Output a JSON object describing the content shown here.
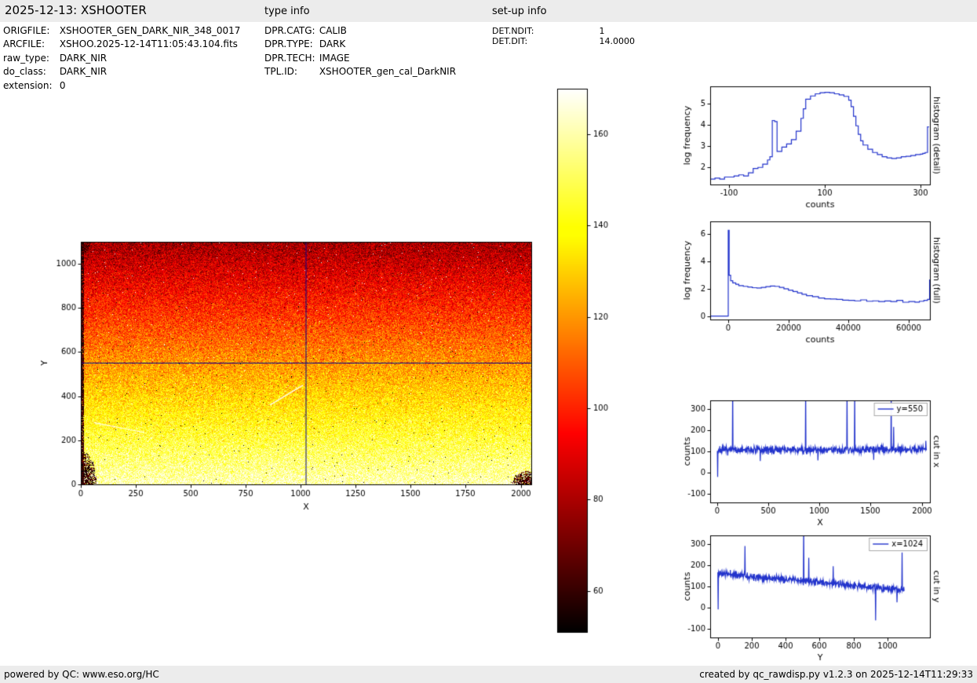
{
  "header": {
    "title": "2025-12-13: XSHOOTER",
    "type_info_label": "type info",
    "setup_info_label": "set-up info"
  },
  "file_info": {
    "rows": [
      {
        "label": "ORIGFILE:",
        "value": "XSHOOTER_GEN_DARK_NIR_348_0017"
      },
      {
        "label": "ARCFILE:",
        "value": "XSHOO.2025-12-14T11:05:43.104.fits"
      },
      {
        "label": "raw_type:",
        "value": "DARK_NIR"
      },
      {
        "label": "do_class:",
        "value": "DARK_NIR"
      },
      {
        "label": "extension:",
        "value": "0"
      }
    ]
  },
  "type_info": {
    "rows": [
      {
        "label": "DPR.CATG:",
        "value": "CALIB"
      },
      {
        "label": "DPR.TYPE:",
        "value": "DARK"
      },
      {
        "label": "DPR.TECH:",
        "value": "IMAGE"
      },
      {
        "label": "TPL.ID:",
        "value": "XSHOOTER_gen_cal_DarkNIR"
      }
    ]
  },
  "setup_info": {
    "rows": [
      {
        "label": "DET.NDIT:",
        "value": "1"
      },
      {
        "label": "DET.DIT:",
        "value": "14.0000"
      }
    ]
  },
  "footer": {
    "left": "powered by QC: www.eso.org/HC",
    "right": "created by qc_rawdisp.py v1.2.3 on 2025-12-14T11:29:33"
  },
  "colors": {
    "line_blue": "#2233cc",
    "crosshair": "#00008b",
    "bar_bg": "#ececec",
    "axis": "#000000"
  },
  "chart_data": [
    {
      "id": "detector_image",
      "type": "heatmap",
      "description": "raw NIR dark frame, brightness decreasing from bottom (~160 counts) to top (~80 counts), hot colormap, scattered hot/dead pixels, dark detector edges bottom-left and bottom-right",
      "xlabel": "X",
      "ylabel": "Y",
      "xlim": [
        0,
        2048
      ],
      "ylim": [
        0,
        1100
      ],
      "x_ticks": [
        0,
        250,
        500,
        750,
        1000,
        1250,
        1500,
        1750,
        2000
      ],
      "y_ticks": [
        0,
        200,
        400,
        600,
        800,
        1000
      ],
      "colormap": "hot",
      "display_min": 51,
      "display_max": 170,
      "counts_bottom": 162,
      "counts_top": 78,
      "noise_sigma": 9,
      "crosshair": {
        "x": 1024,
        "y": 550
      }
    },
    {
      "id": "colorbar",
      "type": "colorbar",
      "ticks": [
        60,
        80,
        100,
        120,
        140,
        160
      ],
      "display_min": 51,
      "display_max": 170,
      "colormap": "hot"
    },
    {
      "id": "histogram_detail",
      "type": "line",
      "style": "step",
      "right_label": "histogram (detail)",
      "xlabel": "counts",
      "ylabel": "log frequency",
      "xlim": [
        -140,
        320
      ],
      "ylim": [
        1.2,
        5.8
      ],
      "x_ticks": [
        -100,
        100,
        300
      ],
      "y_ticks": [
        2,
        3,
        4,
        5
      ],
      "x": [
        -140,
        -130,
        -120,
        -110,
        -100,
        -90,
        -80,
        -70,
        -60,
        -50,
        -40,
        -30,
        -20,
        -15,
        -10,
        -5,
        0,
        10,
        20,
        30,
        40,
        50,
        55,
        60,
        70,
        80,
        90,
        100,
        110,
        120,
        130,
        140,
        150,
        155,
        160,
        165,
        170,
        175,
        180,
        190,
        200,
        210,
        220,
        230,
        240,
        250,
        260,
        270,
        280,
        290,
        300,
        305,
        310,
        315,
        318
      ],
      "y": [
        1.45,
        1.5,
        1.45,
        1.55,
        1.55,
        1.6,
        1.65,
        1.6,
        1.75,
        1.95,
        2.0,
        2.15,
        2.35,
        2.5,
        4.2,
        4.15,
        2.75,
        2.95,
        3.1,
        3.3,
        3.7,
        4.3,
        4.75,
        5.2,
        5.35,
        5.45,
        5.5,
        5.52,
        5.5,
        5.45,
        5.4,
        5.33,
        5.15,
        4.85,
        4.4,
        3.95,
        3.55,
        3.25,
        3.05,
        2.85,
        2.7,
        2.6,
        2.5,
        2.45,
        2.42,
        2.45,
        2.5,
        2.52,
        2.56,
        2.6,
        2.62,
        2.66,
        2.7,
        3.9,
        3.9
      ]
    },
    {
      "id": "histogram_full",
      "type": "line",
      "style": "step",
      "right_label": "histogram (full)",
      "xlabel": "counts",
      "ylabel": "log frequency",
      "xlim": [
        -6000,
        67000
      ],
      "ylim": [
        -0.2,
        6.9
      ],
      "x_ticks": [
        0,
        20000,
        40000,
        60000
      ],
      "y_ticks": [
        0,
        2,
        4,
        6
      ],
      "x": [
        -5800,
        -4000,
        -2000,
        -800,
        -200,
        0,
        300,
        800,
        1500,
        2500,
        3500,
        5000,
        6500,
        8000,
        9500,
        11000,
        12500,
        14000,
        15500,
        17000,
        18500,
        20000,
        21500,
        23000,
        24500,
        26000,
        28000,
        30000,
        32000,
        34000,
        36000,
        38000,
        40000,
        42000,
        44000,
        46000,
        48000,
        50000,
        52000,
        54000,
        56000,
        58000,
        60000,
        62000,
        63500,
        65000,
        66200,
        66900
      ],
      "y": [
        0.05,
        0.05,
        0.05,
        0.05,
        0.05,
        6.25,
        3.0,
        2.6,
        2.45,
        2.35,
        2.25,
        2.2,
        2.15,
        2.1,
        2.08,
        2.12,
        2.18,
        2.22,
        2.2,
        2.12,
        2.02,
        1.92,
        1.82,
        1.72,
        1.62,
        1.52,
        1.45,
        1.35,
        1.3,
        1.28,
        1.25,
        1.2,
        1.18,
        1.15,
        1.22,
        1.12,
        1.15,
        1.1,
        1.14,
        1.1,
        1.18,
        1.05,
        1.1,
        1.06,
        1.12,
        1.18,
        1.25,
        2.7
      ]
    },
    {
      "id": "cut_in_x",
      "type": "line",
      "legend": "y=550",
      "right_label": "cut in x",
      "xlabel": "X",
      "ylabel": "counts",
      "xlim": [
        -70,
        2080
      ],
      "ylim": [
        -140,
        340
      ],
      "x_ticks": [
        0,
        500,
        1000,
        1500,
        2000
      ],
      "y_ticks": [
        -100,
        0,
        100,
        200,
        300
      ],
      "generate": {
        "n": 2048,
        "seed": 7,
        "base_start": 106,
        "base_end": 110,
        "noise_sigma": 9,
        "spikes": [
          {
            "x": 2,
            "y": -20
          },
          {
            "x": 150,
            "y": 400
          },
          {
            "x": 420,
            "y": 55
          },
          {
            "x": 865,
            "y": 400
          },
          {
            "x": 985,
            "y": 58
          },
          {
            "x": 1270,
            "y": 400
          },
          {
            "x": 1345,
            "y": 400
          },
          {
            "x": 1530,
            "y": 60
          },
          {
            "x": 1700,
            "y": 400
          },
          {
            "x": 1725,
            "y": 215
          },
          {
            "x": 2040,
            "y": 150
          }
        ]
      }
    },
    {
      "id": "cut_in_y",
      "type": "line",
      "legend": "x=1024",
      "right_label": "cut in y",
      "xlabel": "Y",
      "ylabel": "counts",
      "xlim": [
        -45,
        1250
      ],
      "ylim": [
        -140,
        340
      ],
      "x_ticks": [
        0,
        200,
        400,
        600,
        800,
        1000
      ],
      "y_ticks": [
        -100,
        0,
        100,
        200,
        300
      ],
      "generate": {
        "n": 1100,
        "seed": 11,
        "base_start": 163,
        "base_end": 82,
        "noise_sigma": 8,
        "spikes": [
          {
            "x": 2,
            "y": -8
          },
          {
            "x": 160,
            "y": 290
          },
          {
            "x": 505,
            "y": 400
          },
          {
            "x": 535,
            "y": 235
          },
          {
            "x": 680,
            "y": 195
          },
          {
            "x": 930,
            "y": -60
          },
          {
            "x": 1055,
            "y": 25
          },
          {
            "x": 1085,
            "y": 260
          }
        ]
      }
    }
  ]
}
